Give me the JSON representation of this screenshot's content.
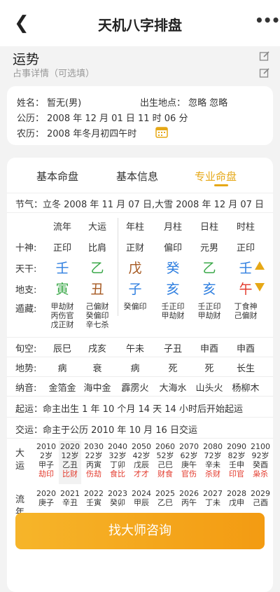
{
  "nav": {
    "title": "天机八字排盘",
    "back_icon": "chevron-left-icon",
    "more_icon": "more-icon"
  },
  "section": {
    "title": "运势",
    "subtitle": "占事详情（可选填）"
  },
  "info": {
    "name_label": "姓名：",
    "name_value": "暂无(男)",
    "birthplace_label": "出生地点：",
    "birthplace_value": "忽略 忽略",
    "solar_label": "公历：",
    "solar_value": "2008 年 12 月 01 日 11 时 06 分",
    "lunar_label": "农历：",
    "lunar_value": "2008 年冬月初四午时"
  },
  "tabs": [
    "基本命盘",
    "基本信息",
    "专业命盘"
  ],
  "jieqi": "节气：立冬 2008 年 11 月 07 日,大雪 2008 年 12 月 07 日",
  "columns": [
    "流年",
    "大运",
    "年柱",
    "月柱",
    "日柱",
    "时柱"
  ],
  "rows": {
    "shishen_label": "十神:",
    "shishen": [
      "正印",
      "比肩",
      "正财",
      "偏印",
      "元男",
      "正印"
    ],
    "tiangan_label": "天干:",
    "tiangan": [
      "壬",
      "乙",
      "戊",
      "癸",
      "乙",
      "壬"
    ],
    "dizhi_label": "地支:",
    "dizhi": [
      "寅",
      "丑",
      "子",
      "亥",
      "亥",
      "午"
    ],
    "canggan_label": "遁藏:",
    "canggan": [
      [
        "甲劫财",
        "丙伤官",
        "戊正财"
      ],
      [
        "己偏财",
        "癸偏印",
        "辛七杀"
      ],
      [
        "癸偏印"
      ],
      [
        "壬正印",
        "甲劫财"
      ],
      [
        "壬正印",
        "甲劫财"
      ],
      [
        "丁食神",
        "己偏财"
      ]
    ],
    "xunkong_label": "旬空:",
    "xunkong": [
      "辰巳",
      "戌亥",
      "午未",
      "子丑",
      "申酉",
      "申酉"
    ],
    "dishi_label": "地势:",
    "dishi": [
      "病",
      "衰",
      "病",
      "死",
      "死",
      "长生"
    ],
    "nayin_label": "纳音:",
    "nayin": [
      "金箔金",
      "海中金",
      "霹雳火",
      "大海水",
      "山头火",
      "杨柳木"
    ]
  },
  "qiyun": "起运：命主出生 1 年 10 个月 14 天 14 小时后开始起运",
  "jiaoyun": "交运：命主于公历 2010 年 10 月 16 日交运",
  "dayun_label": "大运",
  "dayun": [
    {
      "year": "2010",
      "age": "2岁",
      "gz": "甲子",
      "tag": "劫印"
    },
    {
      "year": "2020",
      "age": "12岁",
      "gz": "乙丑",
      "tag": "比财"
    },
    {
      "year": "2030",
      "age": "22岁",
      "gz": "丙寅",
      "tag": "伤劫"
    },
    {
      "year": "2040",
      "age": "32岁",
      "gz": "丁卯",
      "tag": "食比"
    },
    {
      "year": "2050",
      "age": "42岁",
      "gz": "戊辰",
      "tag": "才才"
    },
    {
      "year": "2060",
      "age": "52岁",
      "gz": "己巳",
      "tag": "财食"
    },
    {
      "year": "2070",
      "age": "62岁",
      "gz": "庚午",
      "tag": "官伤"
    },
    {
      "year": "2080",
      "age": "72岁",
      "gz": "辛未",
      "tag": "杀财"
    },
    {
      "year": "2090",
      "age": "82岁",
      "gz": "壬申",
      "tag": "印官"
    },
    {
      "year": "2100",
      "age": "92岁",
      "gz": "癸酉",
      "tag": "枭杀"
    }
  ],
  "liunian_label": "流年",
  "liunian": [
    {
      "year": "2020",
      "gz": "庚子"
    },
    {
      "year": "2021",
      "gz": "辛丑"
    },
    {
      "year": "2022",
      "gz": "壬寅"
    },
    {
      "year": "2023",
      "gz": "癸卯"
    },
    {
      "year": "2024",
      "gz": "甲辰"
    },
    {
      "year": "2025",
      "gz": "乙巳"
    },
    {
      "year": "2026",
      "gz": "丙午"
    },
    {
      "year": "2027",
      "gz": "丁未"
    },
    {
      "year": "2028",
      "gz": "戊申"
    },
    {
      "year": "2029",
      "gz": "己酉"
    }
  ],
  "cta_label": "找大师咨询",
  "colors": {
    "accent": "#e6a817",
    "wood": "#3aa848",
    "water": "#2f7fe0",
    "fire": "#e33b2e",
    "earth": "#a5571f",
    "metal": "#e6a817"
  }
}
